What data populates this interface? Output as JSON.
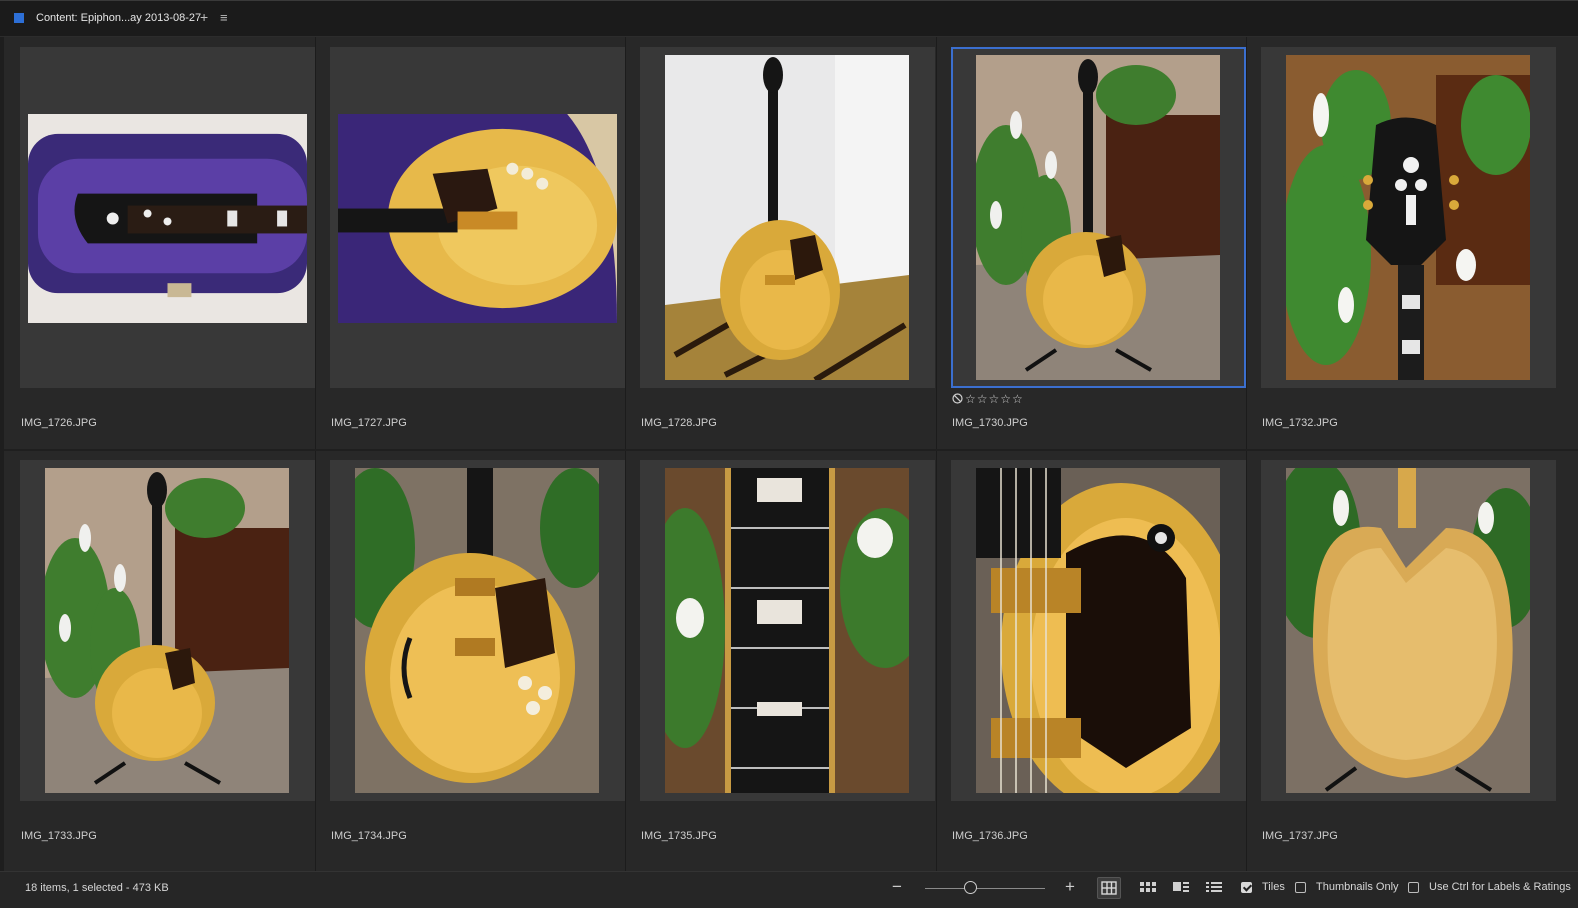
{
  "panel": {
    "title": "Content: Epiphon...ay 2013-08-27",
    "add_icon": "+",
    "menu_icon": "≡"
  },
  "items": [
    {
      "filename": "IMG_1726.JPG",
      "selected": false,
      "orientation": "landscape",
      "scene": "case"
    },
    {
      "filename": "IMG_1727.JPG",
      "selected": false,
      "orientation": "landscape",
      "scene": "case-body"
    },
    {
      "filename": "IMG_1728.JPG",
      "selected": false,
      "orientation": "portrait",
      "scene": "full-room"
    },
    {
      "filename": "IMG_1730.JPG",
      "selected": true,
      "orientation": "portrait",
      "scene": "full-plants"
    },
    {
      "filename": "IMG_1732.JPG",
      "selected": false,
      "orientation": "portrait",
      "scene": "headstock"
    },
    {
      "filename": "IMG_1733.JPG",
      "selected": false,
      "orientation": "portrait",
      "scene": "full-plants"
    },
    {
      "filename": "IMG_1734.JPG",
      "selected": false,
      "orientation": "portrait",
      "scene": "body-close"
    },
    {
      "filename": "IMG_1735.JPG",
      "selected": false,
      "orientation": "portrait",
      "scene": "fretboard"
    },
    {
      "filename": "IMG_1736.JPG",
      "selected": false,
      "orientation": "portrait",
      "scene": "pickups"
    },
    {
      "filename": "IMG_1737.JPG",
      "selected": false,
      "orientation": "portrait",
      "scene": "back"
    }
  ],
  "selected_rating": {
    "reject_icon": "⃠",
    "stars": "☆☆☆☆☆"
  },
  "status": {
    "text": "18 items, 1 selected - 473 KB",
    "zoom_out": "−",
    "zoom_in": "+",
    "tiles_label": "Tiles",
    "tiles_checked": true,
    "thumbs_label": "Thumbnails Only",
    "thumbs_checked": false,
    "ctrl_label": "Use Ctrl for Labels & Ratings",
    "ctrl_checked": false
  },
  "colors": {
    "accent": "#3b6fcf",
    "panel_bg": "#282828",
    "tile_bg": "#383838"
  }
}
